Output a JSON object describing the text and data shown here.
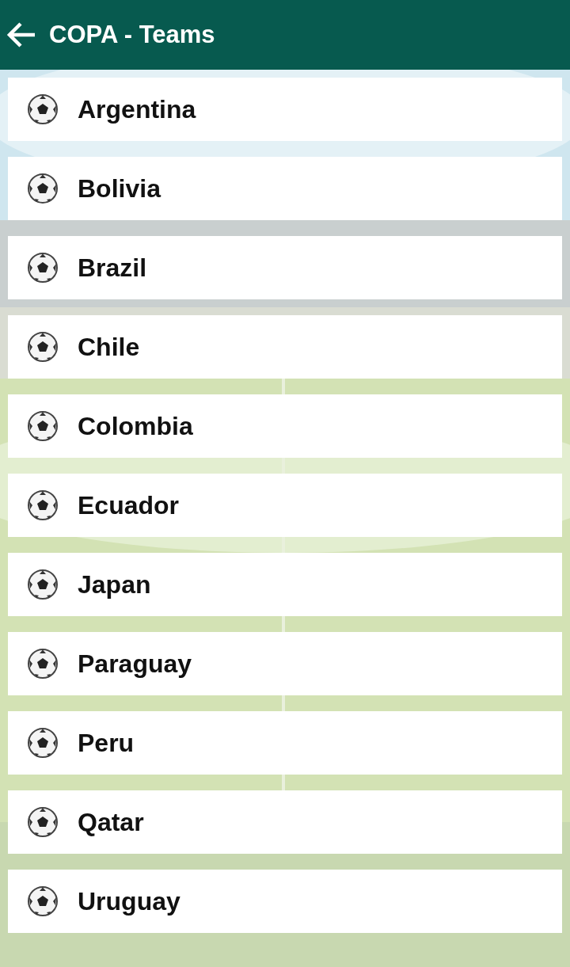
{
  "app_bar": {
    "title": "COPA - Teams"
  },
  "teams": [
    {
      "name": "Argentina"
    },
    {
      "name": "Bolivia"
    },
    {
      "name": "Brazil"
    },
    {
      "name": "Chile"
    },
    {
      "name": "Colombia"
    },
    {
      "name": "Ecuador"
    },
    {
      "name": "Japan"
    },
    {
      "name": "Paraguay"
    },
    {
      "name": "Peru"
    },
    {
      "name": "Qatar"
    },
    {
      "name": "Uruguay"
    }
  ]
}
